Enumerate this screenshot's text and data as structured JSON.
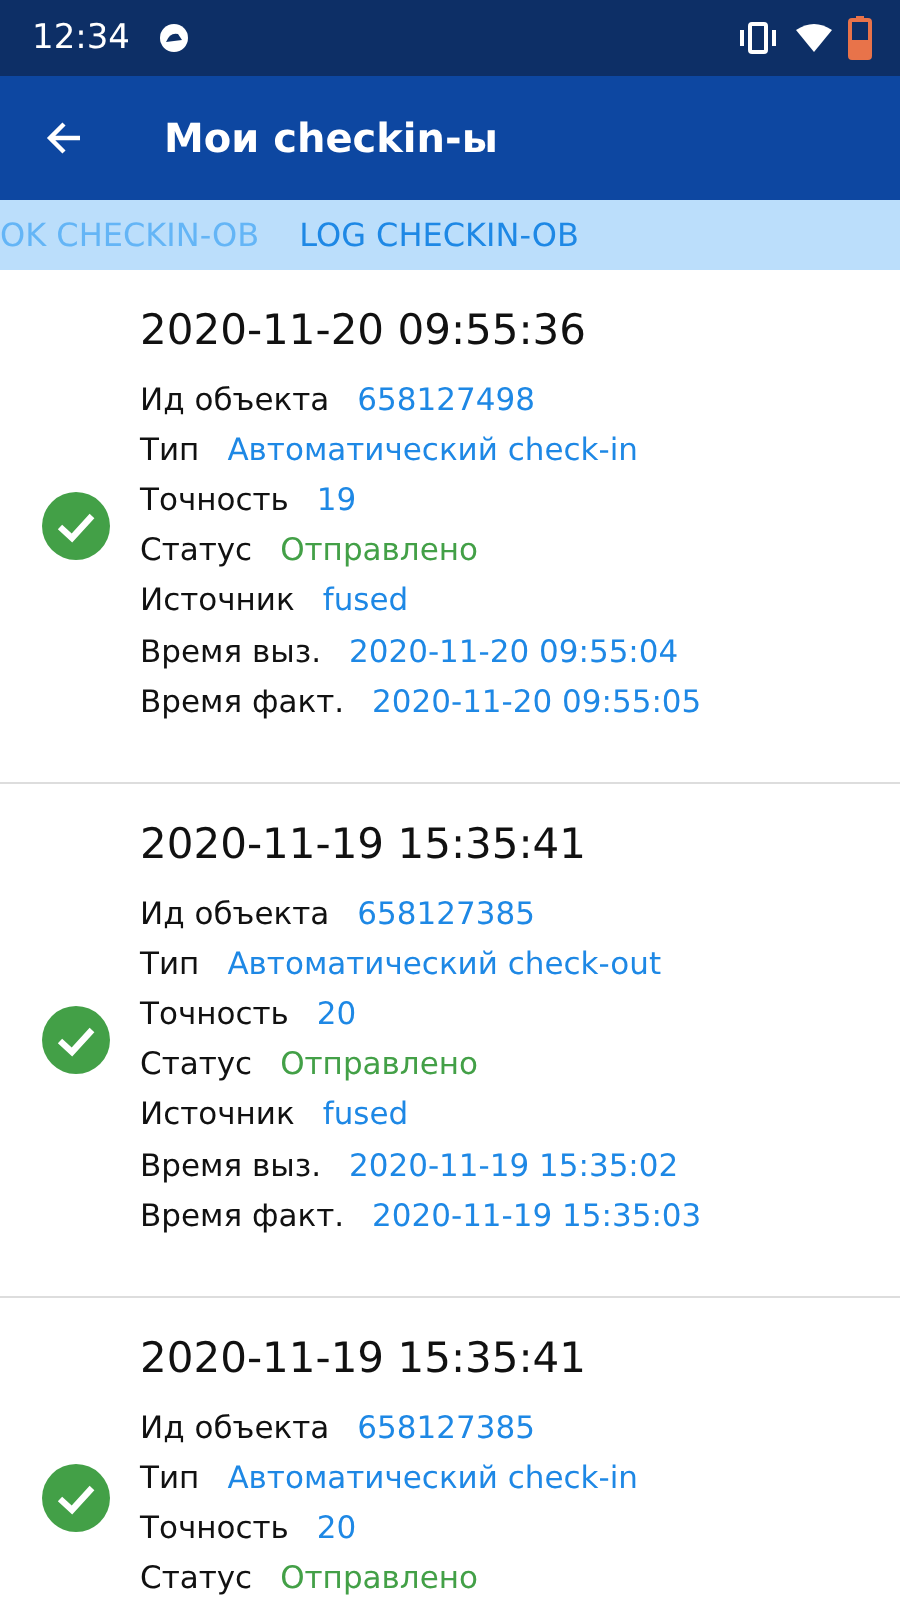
{
  "status_bar": {
    "time": "12:34"
  },
  "app_bar": {
    "title": "Мои checkin-ы"
  },
  "tabs": [
    {
      "label": "OK CHECKIN-OB",
      "selected": false
    },
    {
      "label": "LOG CHECKIN-OB",
      "selected": true
    }
  ],
  "entries": [
    {
      "timestamp": "2020-11-20 09:55:36",
      "sent": true,
      "fields": [
        {
          "label": "Ид объекта",
          "value": "658127498",
          "kind": "text"
        },
        {
          "label": "Тип",
          "value": "Автоматический check-in",
          "kind": "text"
        },
        {
          "label": "Точность",
          "value": "19",
          "kind": "text"
        },
        {
          "label": "Статус",
          "value": "Отправлено",
          "kind": "status"
        },
        {
          "label": "Источник",
          "value": "fused",
          "kind": "text"
        },
        {
          "label": "Время выз.",
          "value": "2020-11-20 09:55:04",
          "kind": "text"
        },
        {
          "label": "Время факт.",
          "value": "2020-11-20 09:55:05",
          "kind": "text"
        }
      ]
    },
    {
      "timestamp": "2020-11-19 15:35:41",
      "sent": true,
      "fields": [
        {
          "label": "Ид объекта",
          "value": "658127385",
          "kind": "text"
        },
        {
          "label": "Тип",
          "value": "Автоматический check-out",
          "kind": "text"
        },
        {
          "label": "Точность",
          "value": "20",
          "kind": "text"
        },
        {
          "label": "Статус",
          "value": "Отправлено",
          "kind": "status"
        },
        {
          "label": "Источник",
          "value": "fused",
          "kind": "text"
        },
        {
          "label": "Время выз.",
          "value": "2020-11-19 15:35:02",
          "kind": "text"
        },
        {
          "label": "Время факт.",
          "value": "2020-11-19 15:35:03",
          "kind": "text"
        }
      ]
    },
    {
      "timestamp": "2020-11-19 15:35:41",
      "sent": true,
      "fields": [
        {
          "label": "Ид объекта",
          "value": "658127385",
          "kind": "text"
        },
        {
          "label": "Тип",
          "value": "Автоматический check-in",
          "kind": "text"
        },
        {
          "label": "Точность",
          "value": "20",
          "kind": "text"
        },
        {
          "label": "Статус",
          "value": "Отправлено",
          "kind": "status"
        }
      ]
    }
  ]
}
